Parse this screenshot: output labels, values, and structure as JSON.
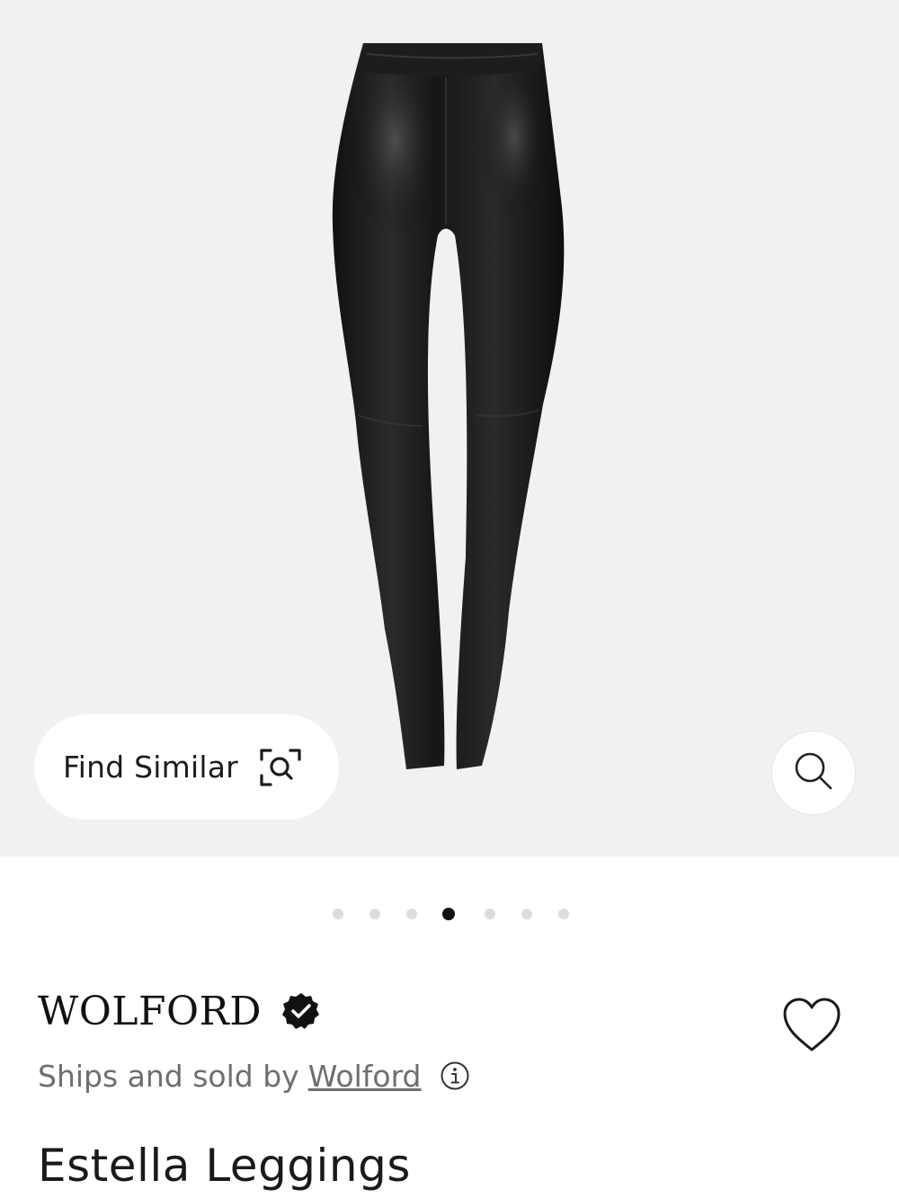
{
  "product_gallery": {
    "find_similar_label": "Find Similar",
    "find_similar_icon": "visual-search-scan-icon",
    "zoom_icon": "search-magnifier-icon",
    "image_count": 7,
    "active_image_index": 3
  },
  "product": {
    "brand": "WOLFORD",
    "verified_icon": "verified-badge-icon",
    "ships_text": "Ships and sold by",
    "seller_name": "Wolford",
    "info_icon": "info-circle-icon",
    "wishlist_icon": "heart-outline-icon",
    "title": "Estella Leggings"
  },
  "colors": {
    "hero_background": "#f1f1f1",
    "active_dot": "#111111",
    "inactive_dot": "#dcdcdc",
    "secondary_text": "#6e6e6e"
  }
}
